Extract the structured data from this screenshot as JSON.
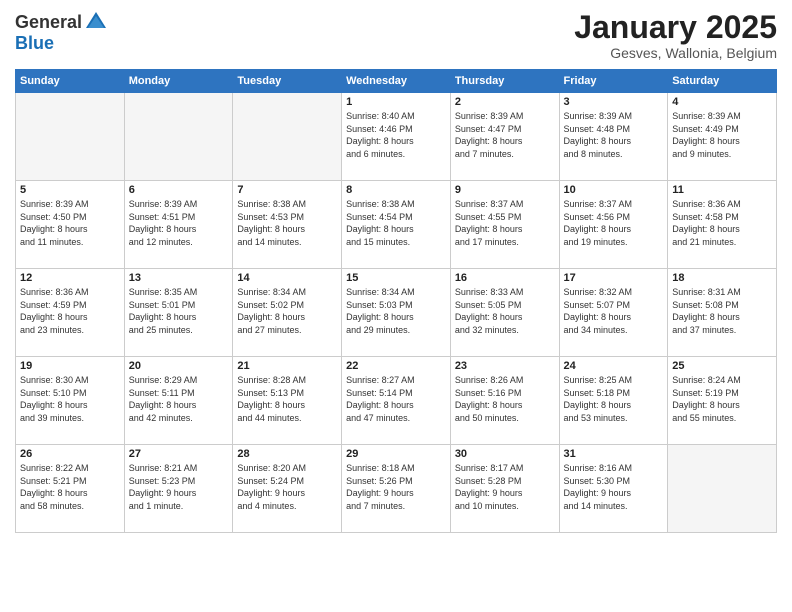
{
  "header": {
    "logo_general": "General",
    "logo_blue": "Blue",
    "title": "January 2025",
    "location": "Gesves, Wallonia, Belgium"
  },
  "days_of_week": [
    "Sunday",
    "Monday",
    "Tuesday",
    "Wednesday",
    "Thursday",
    "Friday",
    "Saturday"
  ],
  "weeks": [
    [
      {
        "day": "",
        "info": ""
      },
      {
        "day": "",
        "info": ""
      },
      {
        "day": "",
        "info": ""
      },
      {
        "day": "1",
        "info": "Sunrise: 8:40 AM\nSunset: 4:46 PM\nDaylight: 8 hours\nand 6 minutes."
      },
      {
        "day": "2",
        "info": "Sunrise: 8:39 AM\nSunset: 4:47 PM\nDaylight: 8 hours\nand 7 minutes."
      },
      {
        "day": "3",
        "info": "Sunrise: 8:39 AM\nSunset: 4:48 PM\nDaylight: 8 hours\nand 8 minutes."
      },
      {
        "day": "4",
        "info": "Sunrise: 8:39 AM\nSunset: 4:49 PM\nDaylight: 8 hours\nand 9 minutes."
      }
    ],
    [
      {
        "day": "5",
        "info": "Sunrise: 8:39 AM\nSunset: 4:50 PM\nDaylight: 8 hours\nand 11 minutes."
      },
      {
        "day": "6",
        "info": "Sunrise: 8:39 AM\nSunset: 4:51 PM\nDaylight: 8 hours\nand 12 minutes."
      },
      {
        "day": "7",
        "info": "Sunrise: 8:38 AM\nSunset: 4:53 PM\nDaylight: 8 hours\nand 14 minutes."
      },
      {
        "day": "8",
        "info": "Sunrise: 8:38 AM\nSunset: 4:54 PM\nDaylight: 8 hours\nand 15 minutes."
      },
      {
        "day": "9",
        "info": "Sunrise: 8:37 AM\nSunset: 4:55 PM\nDaylight: 8 hours\nand 17 minutes."
      },
      {
        "day": "10",
        "info": "Sunrise: 8:37 AM\nSunset: 4:56 PM\nDaylight: 8 hours\nand 19 minutes."
      },
      {
        "day": "11",
        "info": "Sunrise: 8:36 AM\nSunset: 4:58 PM\nDaylight: 8 hours\nand 21 minutes."
      }
    ],
    [
      {
        "day": "12",
        "info": "Sunrise: 8:36 AM\nSunset: 4:59 PM\nDaylight: 8 hours\nand 23 minutes."
      },
      {
        "day": "13",
        "info": "Sunrise: 8:35 AM\nSunset: 5:01 PM\nDaylight: 8 hours\nand 25 minutes."
      },
      {
        "day": "14",
        "info": "Sunrise: 8:34 AM\nSunset: 5:02 PM\nDaylight: 8 hours\nand 27 minutes."
      },
      {
        "day": "15",
        "info": "Sunrise: 8:34 AM\nSunset: 5:03 PM\nDaylight: 8 hours\nand 29 minutes."
      },
      {
        "day": "16",
        "info": "Sunrise: 8:33 AM\nSunset: 5:05 PM\nDaylight: 8 hours\nand 32 minutes."
      },
      {
        "day": "17",
        "info": "Sunrise: 8:32 AM\nSunset: 5:07 PM\nDaylight: 8 hours\nand 34 minutes."
      },
      {
        "day": "18",
        "info": "Sunrise: 8:31 AM\nSunset: 5:08 PM\nDaylight: 8 hours\nand 37 minutes."
      }
    ],
    [
      {
        "day": "19",
        "info": "Sunrise: 8:30 AM\nSunset: 5:10 PM\nDaylight: 8 hours\nand 39 minutes."
      },
      {
        "day": "20",
        "info": "Sunrise: 8:29 AM\nSunset: 5:11 PM\nDaylight: 8 hours\nand 42 minutes."
      },
      {
        "day": "21",
        "info": "Sunrise: 8:28 AM\nSunset: 5:13 PM\nDaylight: 8 hours\nand 44 minutes."
      },
      {
        "day": "22",
        "info": "Sunrise: 8:27 AM\nSunset: 5:14 PM\nDaylight: 8 hours\nand 47 minutes."
      },
      {
        "day": "23",
        "info": "Sunrise: 8:26 AM\nSunset: 5:16 PM\nDaylight: 8 hours\nand 50 minutes."
      },
      {
        "day": "24",
        "info": "Sunrise: 8:25 AM\nSunset: 5:18 PM\nDaylight: 8 hours\nand 53 minutes."
      },
      {
        "day": "25",
        "info": "Sunrise: 8:24 AM\nSunset: 5:19 PM\nDaylight: 8 hours\nand 55 minutes."
      }
    ],
    [
      {
        "day": "26",
        "info": "Sunrise: 8:22 AM\nSunset: 5:21 PM\nDaylight: 8 hours\nand 58 minutes."
      },
      {
        "day": "27",
        "info": "Sunrise: 8:21 AM\nSunset: 5:23 PM\nDaylight: 9 hours\nand 1 minute."
      },
      {
        "day": "28",
        "info": "Sunrise: 8:20 AM\nSunset: 5:24 PM\nDaylight: 9 hours\nand 4 minutes."
      },
      {
        "day": "29",
        "info": "Sunrise: 8:18 AM\nSunset: 5:26 PM\nDaylight: 9 hours\nand 7 minutes."
      },
      {
        "day": "30",
        "info": "Sunrise: 8:17 AM\nSunset: 5:28 PM\nDaylight: 9 hours\nand 10 minutes."
      },
      {
        "day": "31",
        "info": "Sunrise: 8:16 AM\nSunset: 5:30 PM\nDaylight: 9 hours\nand 14 minutes."
      },
      {
        "day": "",
        "info": ""
      }
    ]
  ]
}
